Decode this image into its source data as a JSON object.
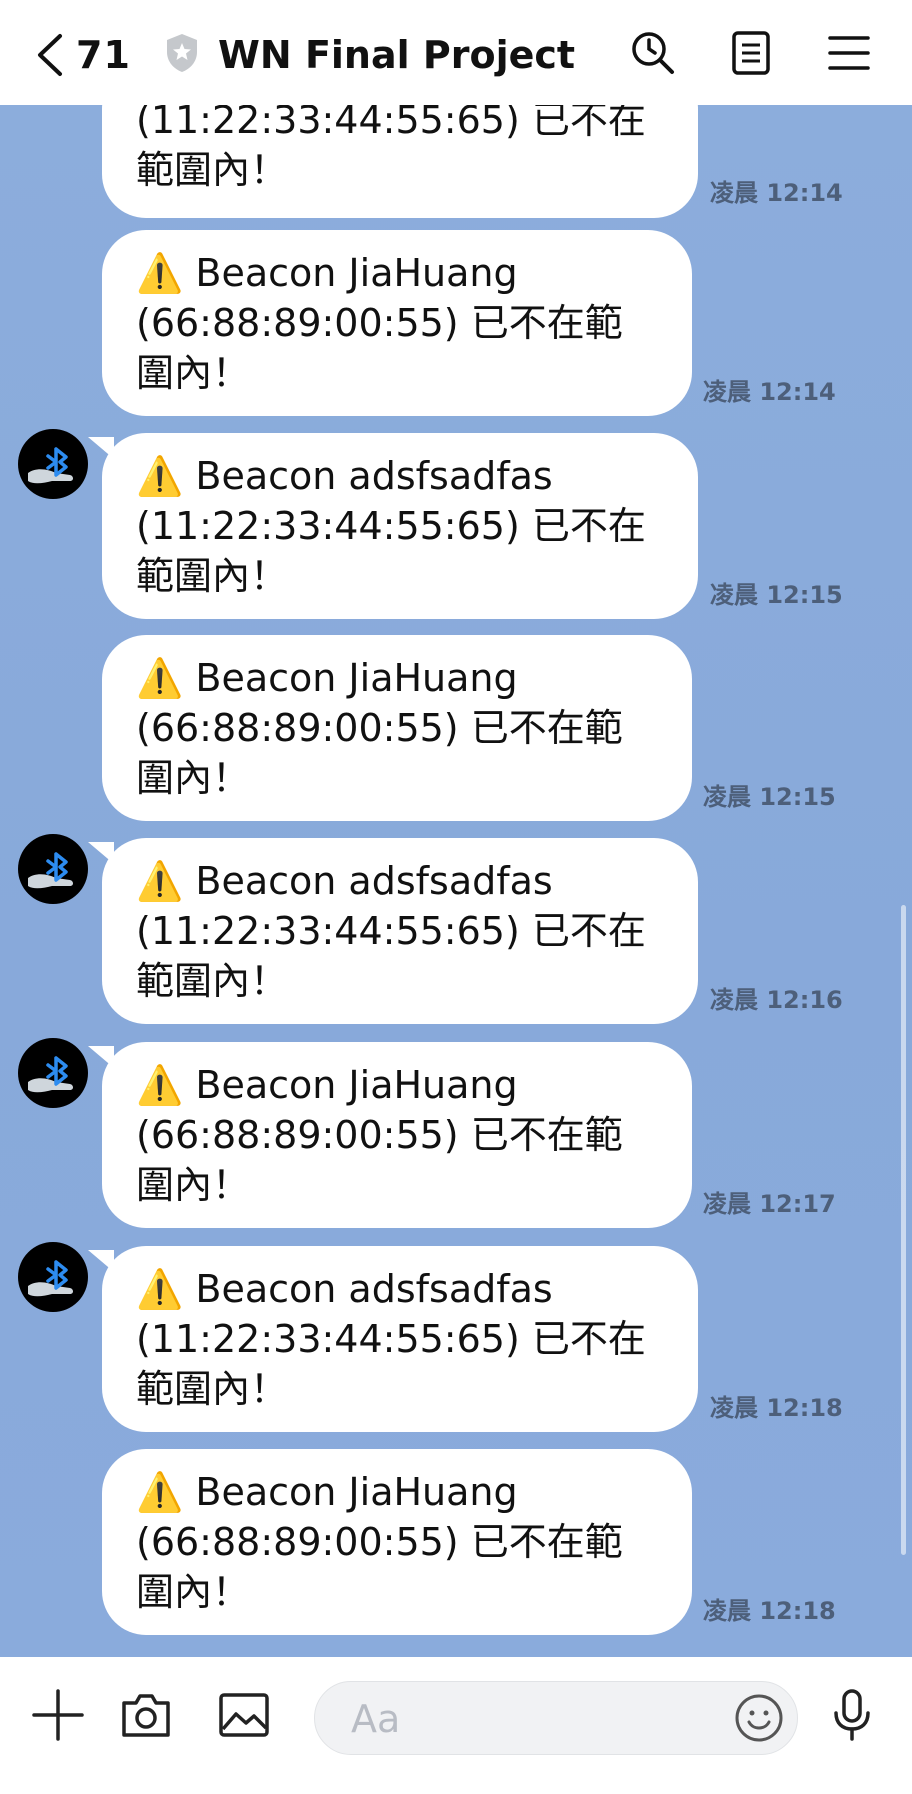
{
  "header": {
    "unread_count": "71",
    "title": "WN Final Project"
  },
  "messages": [
    {
      "text": "(11:22:33:44:55:65) 已不在\n範圍內！",
      "time": "凌晨 12:14"
    },
    {
      "text": "⚠️ Beacon JiaHuang\n(66:88:89:00:55) 已不在範\n圍內！",
      "time": "凌晨 12:14"
    },
    {
      "text": "⚠️ Beacon adsfsadfas\n(11:22:33:44:55:65) 已不在\n範圍內！",
      "time": "凌晨 12:15"
    },
    {
      "text": "⚠️ Beacon JiaHuang\n(66:88:89:00:55) 已不在範\n圍內！",
      "time": "凌晨 12:15"
    },
    {
      "text": "⚠️ Beacon adsfsadfas\n(11:22:33:44:55:65) 已不在\n範圍內！",
      "time": "凌晨 12:16"
    },
    {
      "text": "⚠️ Beacon JiaHuang\n(66:88:89:00:55) 已不在範\n圍內！",
      "time": "凌晨 12:17"
    },
    {
      "text": "⚠️ Beacon adsfsadfas\n(11:22:33:44:55:65) 已不在\n範圍內！",
      "time": "凌晨 12:18"
    },
    {
      "text": "⚠️ Beacon JiaHuang\n(66:88:89:00:55) 已不在範\n圍內！",
      "time": "凌晨 12:18"
    }
  ],
  "composer": {
    "placeholder": "Aa"
  },
  "icons": {
    "back": "chevron-left-icon",
    "shield": "shield-icon",
    "search": "clock-search-icon",
    "notes": "notes-icon",
    "menu": "hamburger-menu-icon",
    "plus": "plus-icon",
    "camera": "camera-icon",
    "image": "image-icon",
    "emoji": "emoji-icon",
    "mic": "microphone-icon",
    "avatar": "bluetooth-hand-avatar"
  },
  "colors": {
    "chat_background": "#8caddc",
    "bubble": "#ffffff",
    "warning": "#f4c20d",
    "bluetooth": "#2d8cf0"
  }
}
